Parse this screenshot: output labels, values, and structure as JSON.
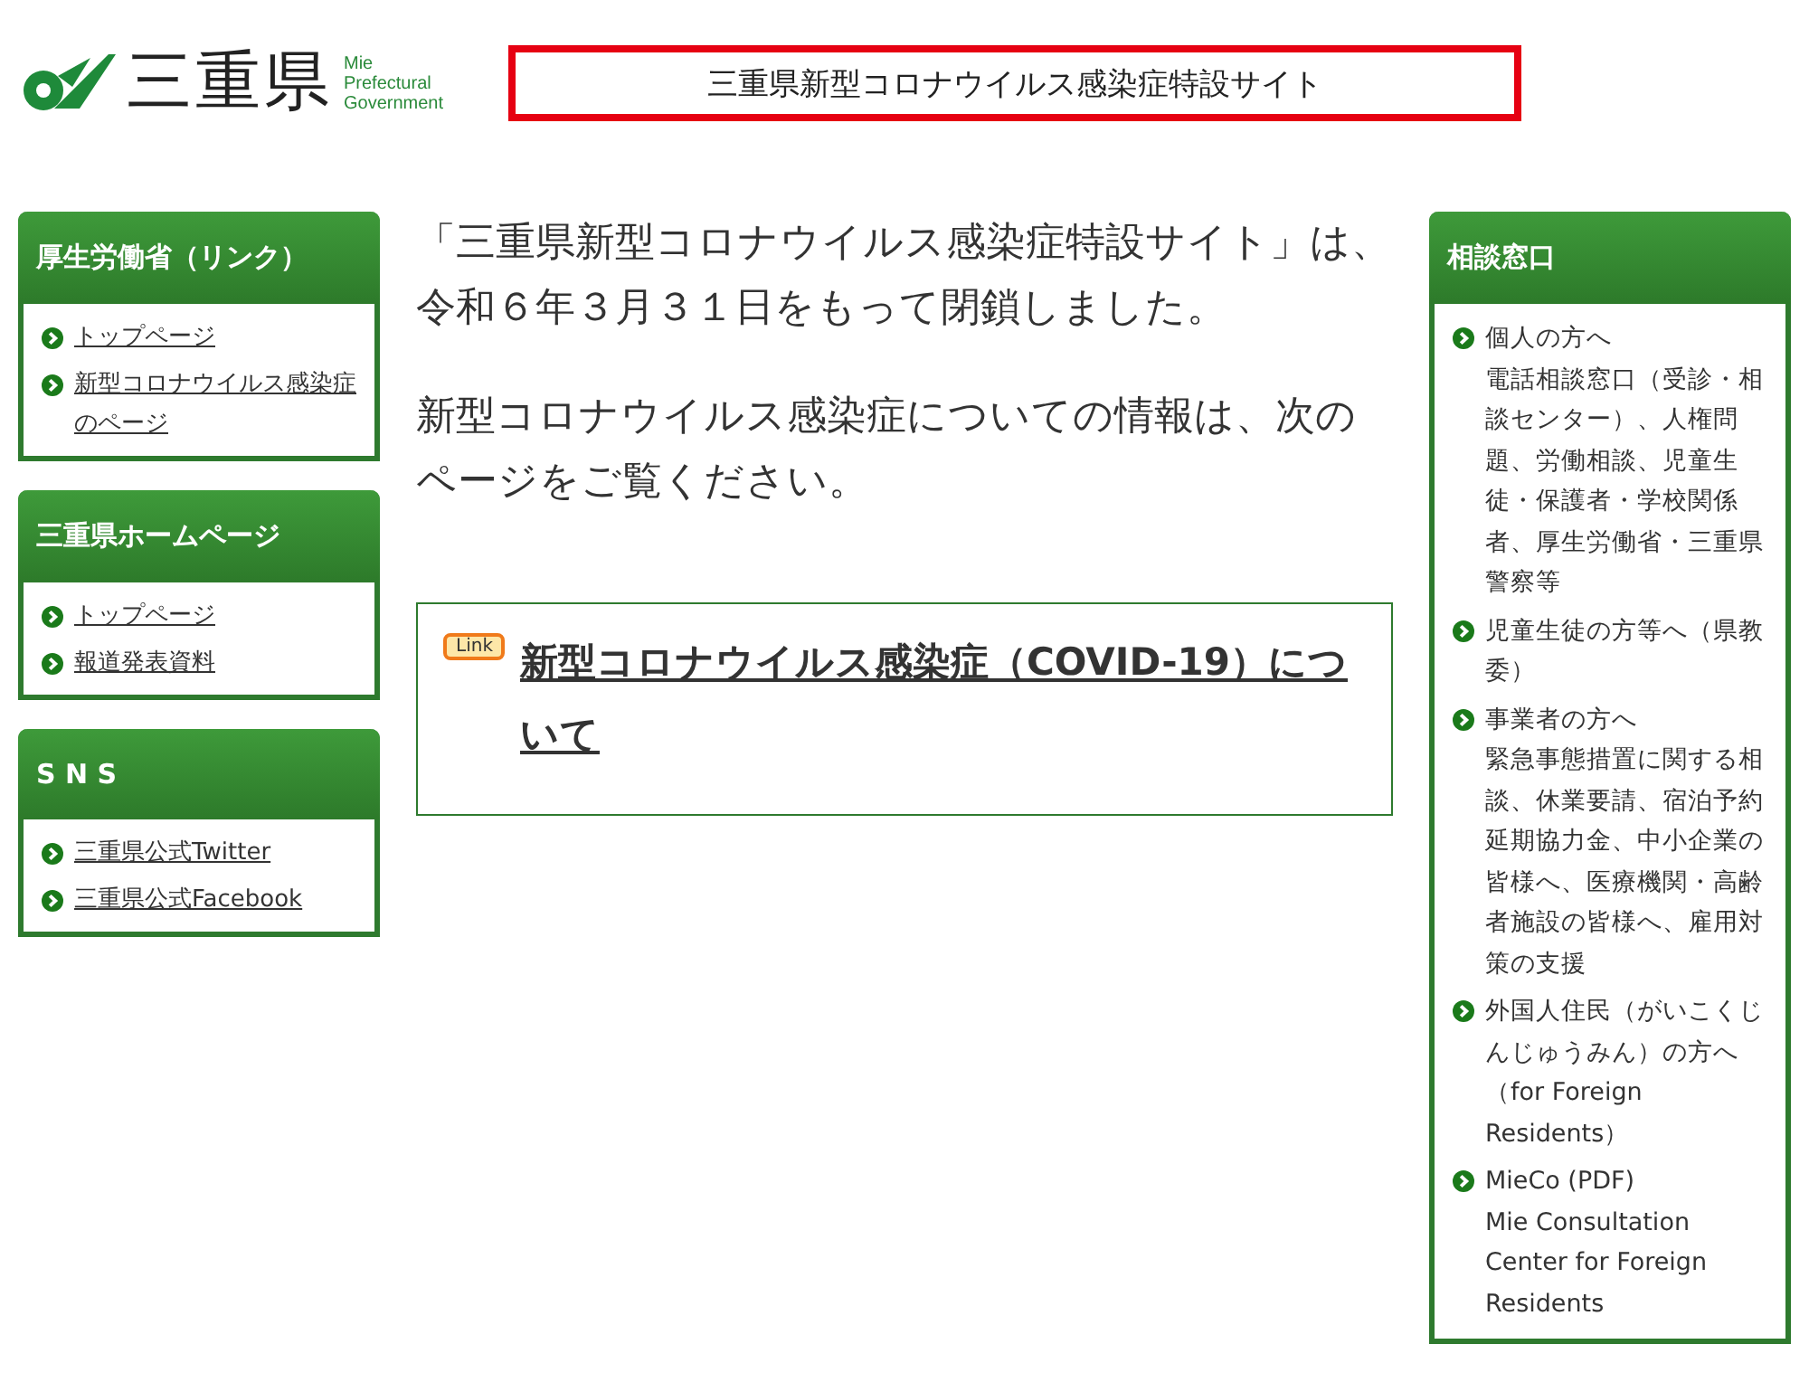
{
  "header": {
    "logo_text": "三重県",
    "logo_subtitle": [
      "Mie",
      "Prefectural",
      "Government"
    ],
    "site_title": "三重県新型コロナウイルス感染症特設サイト"
  },
  "left_panels": [
    {
      "title": "厚生労働省（リンク）",
      "links": [
        "トップページ",
        "新型コロナウイルス感染症のページ"
      ]
    },
    {
      "title": "三重県ホームページ",
      "links": [
        "トップページ",
        "報道発表資料"
      ]
    },
    {
      "title": "S N S",
      "links": [
        "三重県公式Twitter",
        "三重県公式Facebook"
      ]
    }
  ],
  "main": {
    "paragraphs": [
      "「三重県新型コロナウイルス感染症特設サイト」は、令和６年３月３１日をもって閉鎖しました。",
      "新型コロナウイルス感染症についての情報は、次のページをご覧ください。"
    ],
    "link_card": {
      "badge": "Link",
      "text": "新型コロナウイルス感染症（COVID-19）について"
    }
  },
  "right_panel": {
    "title": "相談窓口",
    "items": [
      {
        "title": "個人の方へ",
        "detail": "電話相談窓口（受診・相談センター）、人権問題、労働相談、児童生徒・保護者・学校関係者、厚生労働省・三重県警察等"
      },
      {
        "title": "児童生徒の方等へ（県教委）"
      },
      {
        "title": "事業者の方へ",
        "detail": "緊急事態措置に関する相談、休業要請、宿泊予約延期協力金、中小企業の皆様へ、医療機関・高齢者施設の皆様へ、雇用対策の支援"
      },
      {
        "title": "外国人住民（がいこくじんじゅうみん）の方へ",
        "detail": "（for Foreign Residents）"
      },
      {
        "title": "MieCo (PDF)",
        "detail": "Mie Consultation Center for Foreign Residents"
      }
    ]
  }
}
